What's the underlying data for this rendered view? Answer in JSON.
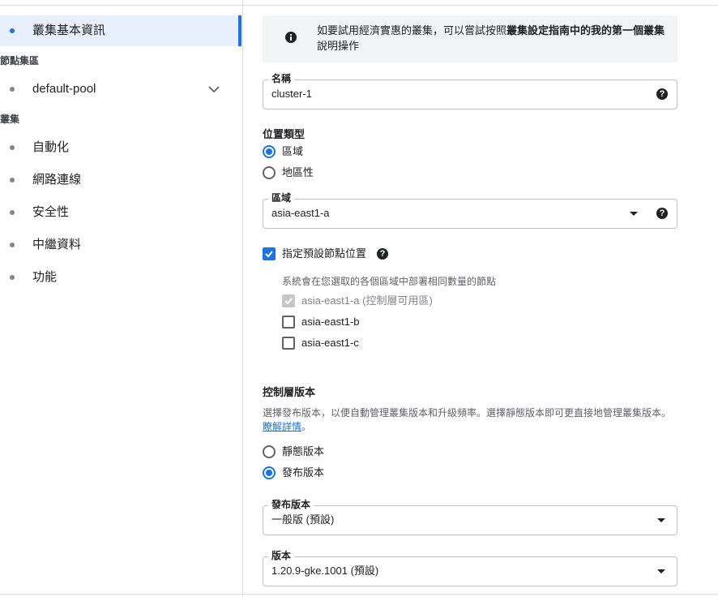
{
  "sidebar": {
    "items": [
      {
        "label": "叢集基本資訊"
      },
      {
        "label": "default-pool"
      },
      {
        "label": "自動化"
      },
      {
        "label": "網路連線"
      },
      {
        "label": "安全性"
      },
      {
        "label": "中繼資料"
      },
      {
        "label": "功能"
      }
    ],
    "sections": {
      "node_pools": "節點集區",
      "cluster": "叢集"
    }
  },
  "banner": {
    "text_prefix": "如要試用經濟實惠的叢集，可以嘗試按照",
    "bold_text": "叢集設定指南中的我的第一個叢集",
    "text_suffix": "說明操作"
  },
  "name_field": {
    "label": "名稱",
    "value": "cluster-1"
  },
  "location_type": {
    "heading": "位置類型",
    "options": [
      {
        "label": "區域",
        "selected": true
      },
      {
        "label": "地區性",
        "selected": false
      }
    ]
  },
  "zone_field": {
    "label": "區域",
    "value": "asia-east1-a"
  },
  "node_locations": {
    "label": "指定預設節點位置",
    "checked": true,
    "note": "系統會在您選取的各個區域中部署相同數量的節點",
    "zones": [
      {
        "label": "asia-east1-a (控制層可用區)",
        "checked": true,
        "disabled": true
      },
      {
        "label": "asia-east1-b",
        "checked": false,
        "disabled": false
      },
      {
        "label": "asia-east1-c",
        "checked": false,
        "disabled": false
      }
    ]
  },
  "control_plane": {
    "heading": "控制層版本",
    "description": "選擇發布版本，以便自動管理叢集版本和升級頻率。選擇靜態版本即可更直接地管理叢集版本。",
    "link": "瞭解詳情",
    "link_suffix": "。",
    "options": [
      {
        "label": "靜態版本",
        "selected": false
      },
      {
        "label": "發布版本",
        "selected": true
      }
    ]
  },
  "release_channel_field": {
    "label": "發布版本",
    "value": "一般版 (預設)"
  },
  "version_field": {
    "label": "版本",
    "value": "1.20.9-gke.1001 (預設)"
  },
  "icons": {
    "help": "?",
    "info": "info-icon"
  },
  "colors": {
    "accent": "#1a73e8",
    "active_bg": "#e8f0fe"
  }
}
